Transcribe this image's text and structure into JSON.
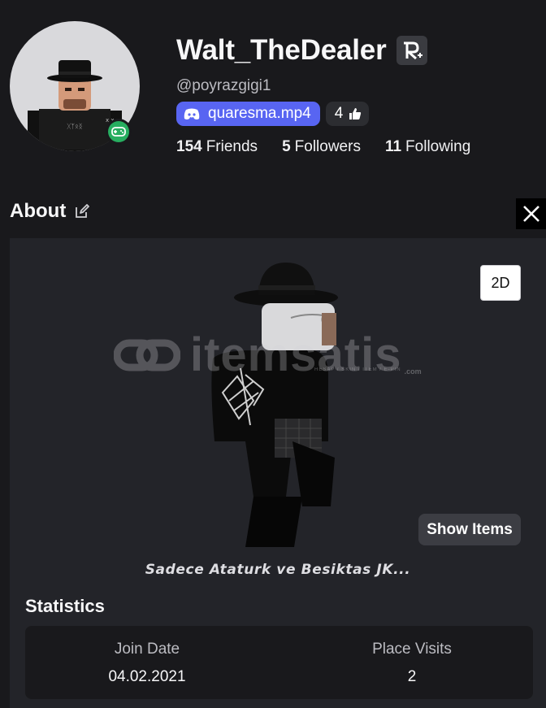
{
  "profile": {
    "display_name": "Walt_TheDealer",
    "username": "@poyrazgigi1",
    "discord_handle": "quaresma.mp4",
    "likes": "4",
    "friends_count": "154",
    "friends_label": "Friends",
    "followers_count": "5",
    "followers_label": "Followers",
    "following_count": "11",
    "following_label": "Following",
    "verified_icon": "r-plus-icon",
    "status_icon": "gamepad-icon",
    "status_color": "#27ae60",
    "discord_color": "#5865f2"
  },
  "about": {
    "title": "About",
    "edit_icon": "edit-icon",
    "social_icon": "x-icon"
  },
  "avatar_view": {
    "toggle_label": "2D",
    "show_items_label": "Show Items",
    "watermark": "itemsatis",
    "watermark_sub": "HESAP / SKIN / ITEM / E-PIN",
    "watermark_com": ".com",
    "bio": "Sadece Ataturk ve Besiktas JK..."
  },
  "statistics": {
    "title": "Statistics",
    "join_date_label": "Join Date",
    "join_date_value": "04.02.2021",
    "place_visits_label": "Place Visits",
    "place_visits_value": "2"
  }
}
